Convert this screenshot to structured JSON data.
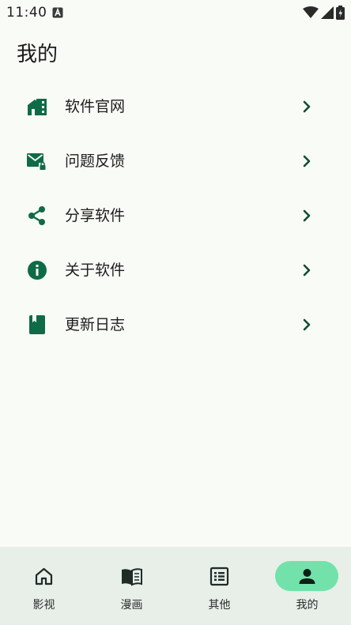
{
  "status_bar": {
    "time": "11:40",
    "notification_icon": "a-letter-badge-icon",
    "icons": [
      "wifi-icon",
      "signal-icon",
      "battery-icon"
    ]
  },
  "page": {
    "title": "我的"
  },
  "menu": {
    "items": [
      {
        "label": "软件官网",
        "icon": "home-building-icon"
      },
      {
        "label": "问题反馈",
        "icon": "mail-lock-icon"
      },
      {
        "label": "分享软件",
        "icon": "share-icon"
      },
      {
        "label": "关于软件",
        "icon": "info-icon"
      },
      {
        "label": "更新日志",
        "icon": "book-icon"
      }
    ],
    "chevron_icon": "chevron-right-icon"
  },
  "bottom_nav": {
    "items": [
      {
        "label": "影视",
        "icon": "home-icon",
        "active": false
      },
      {
        "label": "漫画",
        "icon": "open-book-icon",
        "active": false
      },
      {
        "label": "其他",
        "icon": "list-icon",
        "active": false
      },
      {
        "label": "我的",
        "icon": "person-icon",
        "active": true
      }
    ]
  },
  "colors": {
    "background": "#f9fbf6",
    "accent": "#0f6b47",
    "nav_background": "#e7efe8",
    "active_pill": "#72e2aa"
  }
}
